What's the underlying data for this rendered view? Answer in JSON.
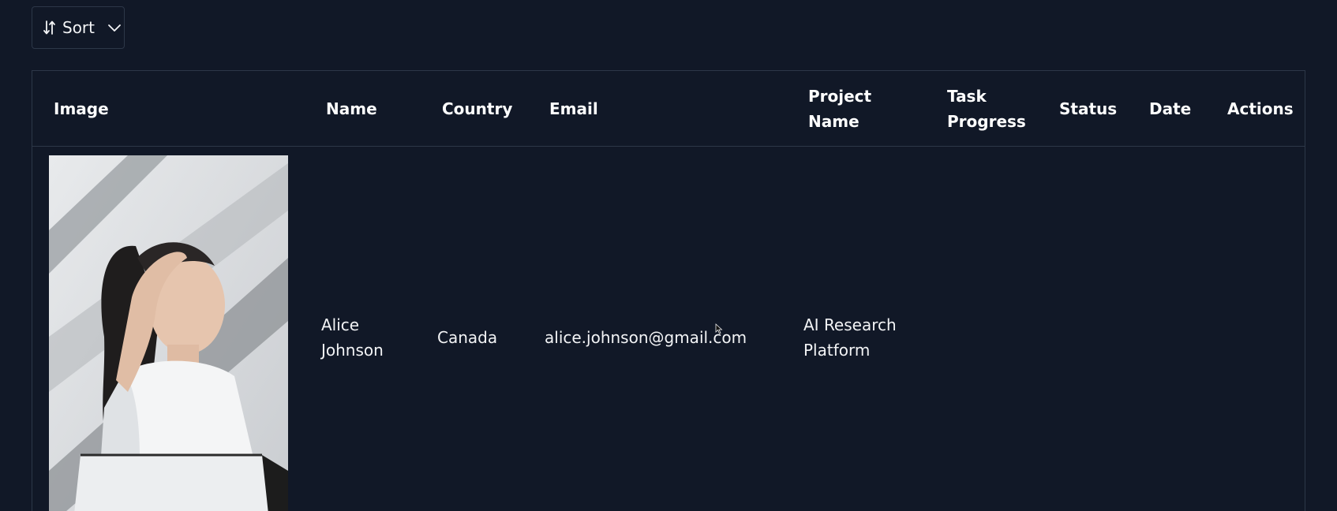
{
  "toolbar": {
    "sort_label": "Sort",
    "sort_icon": "sort-arrows-icon",
    "dropdown_icon": "chevron-down-icon"
  },
  "table": {
    "headers": {
      "image": "Image",
      "name": "Name",
      "country": "Country",
      "email": "Email",
      "project_line1": "Project",
      "project_line2": "Name",
      "task_line1": "Task",
      "task_line2": "Progress",
      "status": "Status",
      "date": "Date",
      "actions": "Actions"
    },
    "rows": [
      {
        "name_line1": "Alice",
        "name_line2": "Johnson",
        "country": "Canada",
        "email": "alice.johnson@gmail.com",
        "project_line1": "AI Research",
        "project_line2": "Platform"
      }
    ]
  },
  "colors": {
    "background": "#111827",
    "border": "#2d3748",
    "text": "#f3f4f6"
  }
}
